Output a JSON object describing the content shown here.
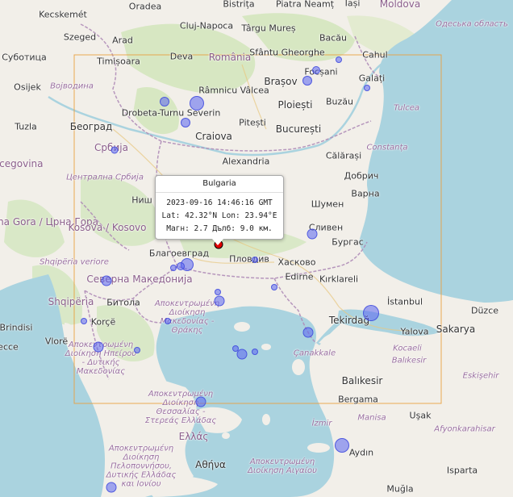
{
  "colors": {
    "land": "#f2efe9",
    "forest": "#c8e0b0",
    "sea": "#aad3df",
    "border": "#b08db8",
    "bbox": "#e8a040",
    "quake": "#5a64f0",
    "selected": "#e00000"
  },
  "popup": {
    "title": "Bulgaria",
    "time": "2023-09-16 14:46:16 GMT",
    "coords": "Lat: 42.32°N Lon: 23.94°E",
    "magnitude": "Магн: 2.7 Дълб: 9.0 км."
  },
  "labels": [
    {
      "id": "kecskemet",
      "text": "Kecskemét",
      "kind": "city"
    },
    {
      "id": "oradea",
      "text": "Oradea",
      "kind": "city"
    },
    {
      "id": "bistrita",
      "text": "Bistrița",
      "kind": "city"
    },
    {
      "id": "piatra",
      "text": "Piatra Neamț",
      "kind": "city"
    },
    {
      "id": "iasi",
      "text": "Iași",
      "kind": "city"
    },
    {
      "id": "moldova",
      "text": "Moldova",
      "kind": "country"
    },
    {
      "id": "odessa",
      "text": "Одеська область",
      "kind": "region"
    },
    {
      "id": "cluj",
      "text": "Cluj-Napoca",
      "kind": "city"
    },
    {
      "id": "targu",
      "text": "Târgu Mureș",
      "kind": "city"
    },
    {
      "id": "bacau",
      "text": "Bacău",
      "kind": "city"
    },
    {
      "id": "szeged",
      "text": "Szeged",
      "kind": "city"
    },
    {
      "id": "arad",
      "text": "Arad",
      "kind": "city"
    },
    {
      "id": "sfantu",
      "text": "Sfântu Gheorghe",
      "kind": "city"
    },
    {
      "id": "cahul",
      "text": "Cahul",
      "kind": "city"
    },
    {
      "id": "subotica",
      "text": "Суботица",
      "kind": "city"
    },
    {
      "id": "timisoara",
      "text": "Timișoara",
      "kind": "city"
    },
    {
      "id": "deva",
      "text": "Deva",
      "kind": "city"
    },
    {
      "id": "romania",
      "text": "România",
      "kind": "country"
    },
    {
      "id": "focsani",
      "text": "Focșani",
      "kind": "city"
    },
    {
      "id": "galati",
      "text": "Galați",
      "kind": "city"
    },
    {
      "id": "osijek",
      "text": "Osijek",
      "kind": "city"
    },
    {
      "id": "vojvodina",
      "text": "Војводина",
      "kind": "region"
    },
    {
      "id": "ramnicu",
      "text": "Râmnicu Vâlcea",
      "kind": "city"
    },
    {
      "id": "brasov",
      "text": "Brașov",
      "kind": "big"
    },
    {
      "id": "buzau",
      "text": "Buzău",
      "kind": "city"
    },
    {
      "id": "ploiesti",
      "text": "Ploiești",
      "kind": "big"
    },
    {
      "id": "tulcea",
      "text": "Tulcea",
      "kind": "region"
    },
    {
      "id": "drobeta",
      "text": "Drobeta-Turnu Severin",
      "kind": "city"
    },
    {
      "id": "pitesti",
      "text": "Pitești",
      "kind": "city"
    },
    {
      "id": "bucuresti",
      "text": "București",
      "kind": "big"
    },
    {
      "id": "tuzla",
      "text": "Tuzla",
      "kind": "city"
    },
    {
      "id": "beograd",
      "text": "Београд",
      "kind": "big"
    },
    {
      "id": "craiova",
      "text": "Craiova",
      "kind": "big"
    },
    {
      "id": "srbija",
      "text": "Србија",
      "kind": "country"
    },
    {
      "id": "alexandria",
      "text": "Alexandria",
      "kind": "city"
    },
    {
      "id": "calarasi",
      "text": "Călărași",
      "kind": "city"
    },
    {
      "id": "constanta",
      "text": "Constanța",
      "kind": "region"
    },
    {
      "id": "herzegovina",
      "text": "rcegovina",
      "kind": "country"
    },
    {
      "id": "centralna",
      "text": "Централна Србија",
      "kind": "region"
    },
    {
      "id": "dobrich",
      "text": "Добрич",
      "kind": "city"
    },
    {
      "id": "varna",
      "text": "Варна",
      "kind": "city"
    },
    {
      "id": "nis",
      "text": "Ниш",
      "kind": "city"
    },
    {
      "id": "shumen",
      "text": "Шумен",
      "kind": "city"
    },
    {
      "id": "crnagora",
      "text": "Crna Gora / Црна Гора",
      "kind": "country"
    },
    {
      "id": "kosovo",
      "text": "Kosova / Kosovo",
      "kind": "country"
    },
    {
      "id": "sliven",
      "text": "Сливен",
      "kind": "city"
    },
    {
      "id": "burgas",
      "text": "Бургас",
      "kind": "city"
    },
    {
      "id": "blagoevgrad",
      "text": "Благоевград",
      "kind": "city"
    },
    {
      "id": "plovdiv",
      "text": "Пловдив",
      "kind": "city"
    },
    {
      "id": "haskovo",
      "text": "Хасково",
      "kind": "city"
    },
    {
      "id": "shqiperia_v",
      "text": "Shqipëria veriore",
      "kind": "region"
    },
    {
      "id": "makedonija",
      "text": "Северна Македонија",
      "kind": "country"
    },
    {
      "id": "edirne",
      "text": "Edirne",
      "kind": "city"
    },
    {
      "id": "kirklareli",
      "text": "Kırklareli",
      "kind": "city"
    },
    {
      "id": "shqiperia",
      "text": "Shqipëria",
      "kind": "country"
    },
    {
      "id": "bitola",
      "text": "Битола",
      "kind": "city"
    },
    {
      "id": "apok1",
      "text": "Αποκεντρωμένη Διοίκηση Μακεδονίας - Θράκης",
      "kind": "region"
    },
    {
      "id": "istanbul",
      "text": "İstanbul",
      "kind": "city"
    },
    {
      "id": "duzce",
      "text": "Düzce",
      "kind": "city"
    },
    {
      "id": "brindisi",
      "text": "Brindisi",
      "kind": "city"
    },
    {
      "id": "korce",
      "text": "Korçë",
      "kind": "city"
    },
    {
      "id": "tekirdag",
      "text": "Tekirdağ",
      "kind": "big"
    },
    {
      "id": "yalova",
      "text": "Yalova",
      "kind": "city"
    },
    {
      "id": "sakarya",
      "text": "Sakarya",
      "kind": "big"
    },
    {
      "id": "lecce",
      "text": "ecce",
      "kind": "city"
    },
    {
      "id": "vlore",
      "text": "Vlorë",
      "kind": "city"
    },
    {
      "id": "apok2",
      "text": "Αποκεντρωμένη Διοίκηση Ηπείρου - Δυτικής Μακεδονίας",
      "kind": "region"
    },
    {
      "id": "canakkale",
      "text": "Çanakkale",
      "kind": "region"
    },
    {
      "id": "kocaeli",
      "text": "Kocaeli",
      "kind": "region"
    },
    {
      "id": "balikesir_r",
      "text": "Balıkesir",
      "kind": "region"
    },
    {
      "id": "eskisehir",
      "text": "Eskişehir",
      "kind": "region"
    },
    {
      "id": "balikesir",
      "text": "Balıkesir",
      "kind": "big"
    },
    {
      "id": "apok3",
      "text": "Αποκεντρωμένη Διοίκηση Θεσσαλίας - Στερεάς Ελλάδας",
      "kind": "region"
    },
    {
      "id": "bergama",
      "text": "Bergama",
      "kind": "city"
    },
    {
      "id": "manisa",
      "text": "Manisa",
      "kind": "region"
    },
    {
      "id": "usak",
      "text": "Uşak",
      "kind": "city"
    },
    {
      "id": "afyon",
      "text": "Afyonkarahisar",
      "kind": "region"
    },
    {
      "id": "ellas",
      "text": "Ελλάς",
      "kind": "country"
    },
    {
      "id": "izmir",
      "text": "İzmir",
      "kind": "region"
    },
    {
      "id": "apok4",
      "text": "Αποκεντρωμένη Διοίκηση Πελοποννήσου, Δυτικής Ελλάδας και Ιονίου",
      "kind": "region"
    },
    {
      "id": "apok5",
      "text": "Αποκεντρωμένη Διοίκηση Αιγαίου",
      "kind": "region"
    },
    {
      "id": "aydin",
      "text": "Aydın",
      "kind": "city"
    },
    {
      "id": "athina",
      "text": "Αθήνα",
      "kind": "big"
    },
    {
      "id": "isparta",
      "text": "Isparta",
      "kind": "city"
    },
    {
      "id": "mugla",
      "text": "Muğla",
      "kind": "city"
    }
  ],
  "quakes": [
    {
      "mag": "large"
    },
    {
      "mag": "medium"
    },
    {
      "mag": "medium"
    },
    {
      "mag": "small"
    }
  ]
}
